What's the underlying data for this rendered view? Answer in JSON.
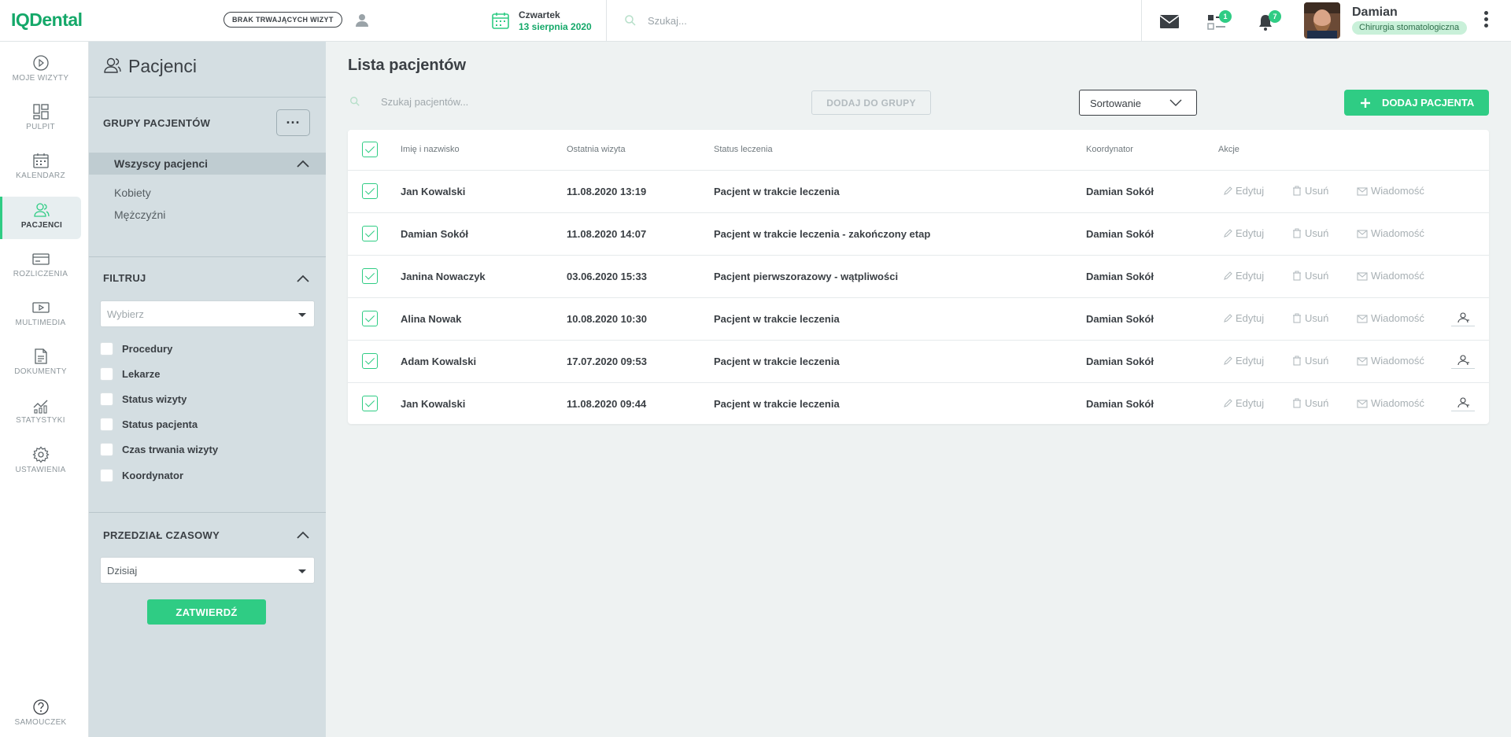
{
  "app": {
    "logo": "IQDental"
  },
  "topbar": {
    "visit_status": "BRAK TRWAJĄCYCH WIZYT",
    "date_day": "Czwartek",
    "date_full": "13 sierpnia 2020",
    "search_placeholder": "Szukaj...",
    "tasks_badge": "1",
    "notifications_badge": "7",
    "user_name": "Damian",
    "user_role": "Chirurgia stomatologiczna"
  },
  "nav": {
    "items": [
      {
        "label": "MOJE WIZYTY",
        "icon": "play-circle-icon"
      },
      {
        "label": "PULPIT",
        "icon": "dashboard-icon"
      },
      {
        "label": "KALENDARZ",
        "icon": "calendar-icon"
      },
      {
        "label": "PACJENCI",
        "icon": "patients-icon"
      },
      {
        "label": "ROZLICZENIA",
        "icon": "card-icon"
      },
      {
        "label": "MULTIMEDIA",
        "icon": "media-icon"
      },
      {
        "label": "DOKUMENTY",
        "icon": "document-icon"
      },
      {
        "label": "STATYSTYKI",
        "icon": "stats-icon"
      },
      {
        "label": "USTAWIENIA",
        "icon": "gear-icon"
      }
    ],
    "help": {
      "label": "SAMOUCZEK",
      "icon": "help-icon"
    }
  },
  "side": {
    "title": "Pacjenci",
    "groups_heading": "GRUPY PACJENTÓW",
    "groups_more": "···",
    "groups": [
      "Wszyscy pacjenci",
      "Kobiety",
      "Mężczyźni"
    ],
    "filter_heading": "FILTRUJ",
    "filter_select_placeholder": "Wybierz",
    "filters": [
      "Procedury",
      "Lekarze",
      "Status wizyty",
      "Status pacjenta",
      "Czas trwania wizyty",
      "Koordynator"
    ],
    "range_heading": "PRZEDZIAŁ CZASOWY",
    "range_value": "Dzisiaj",
    "confirm_label": "ZATWIERDŹ"
  },
  "main": {
    "title": "Lista pacjentów",
    "search_placeholder": "Szukaj pacjentów...",
    "add_to_group_label": "DODAJ DO GRUPY",
    "sort_label": "Sortowanie",
    "add_patient_label": "DODAJ PACJENTA"
  },
  "table": {
    "columns": [
      "Imię i nazwisko",
      "Ostatnia wizyta",
      "Status leczenia",
      "Koordynator",
      "Akcje"
    ],
    "actions": {
      "edit": "Edytuj",
      "delete": "Usuń",
      "message": "Wiadomość"
    },
    "rows": [
      {
        "name": "Jan Kowalski",
        "last_visit": "11.08.2020 13:19",
        "status": "Pacjent w trakcie leczenia",
        "coordinator": "Damian Sokół",
        "has_user_icon": false
      },
      {
        "name": "Damian Sokół",
        "last_visit": "11.08.2020 14:07",
        "status": "Pacjent w trakcie leczenia - zakończony etap",
        "coordinator": "Damian Sokół",
        "has_user_icon": false
      },
      {
        "name": "Janina Nowaczyk",
        "last_visit": "03.06.2020 15:33",
        "status": "Pacjent pierwszorazowy - wątpliwości",
        "coordinator": "Damian Sokół",
        "has_user_icon": false
      },
      {
        "name": "Alina Nowak",
        "last_visit": "10.08.2020 10:30",
        "status": "Pacjent w trakcie leczenia",
        "coordinator": "Damian Sokół",
        "has_user_icon": true
      },
      {
        "name": "Adam Kowalski",
        "last_visit": "17.07.2020 09:53",
        "status": "Pacjent w trakcie leczenia",
        "coordinator": "Damian Sokół",
        "has_user_icon": true
      },
      {
        "name": "Jan Kowalski",
        "last_visit": "11.08.2020 09:44",
        "status": "Pacjent w trakcie leczenia",
        "coordinator": "Damian Sokół",
        "has_user_icon": true
      }
    ]
  },
  "colors": {
    "accent": "#2fcc84",
    "logo": "#14a869",
    "panel": "#d4dee2",
    "background": "#eef2f2"
  }
}
